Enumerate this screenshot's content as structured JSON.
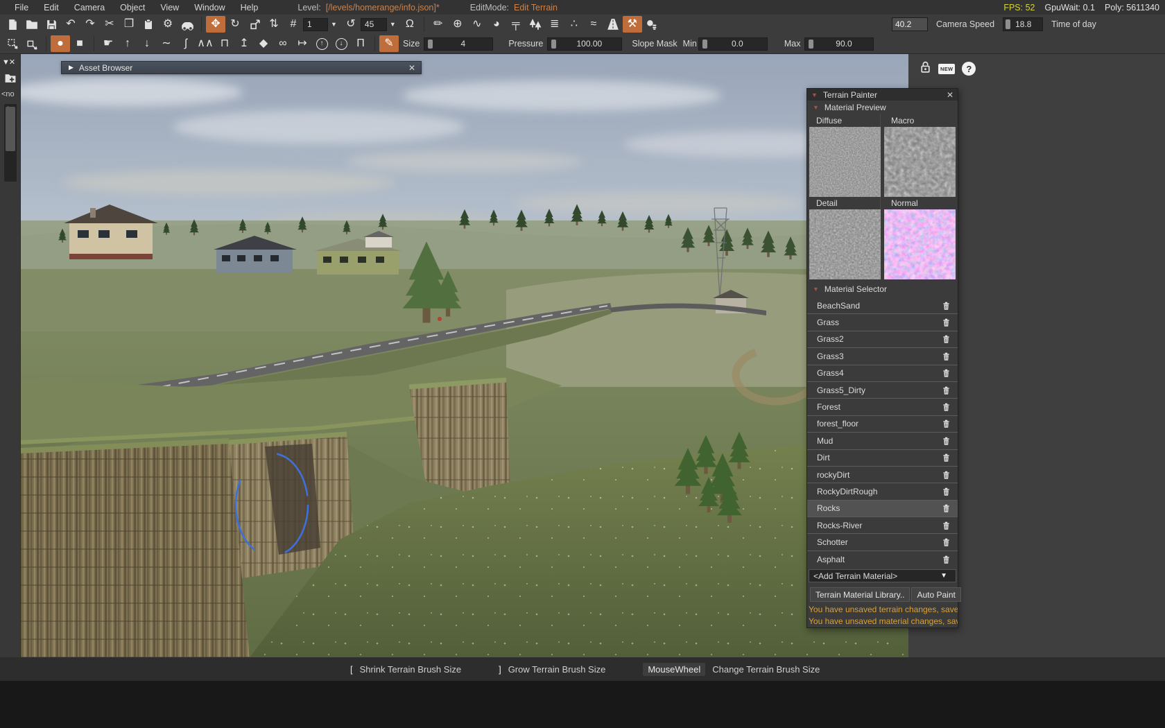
{
  "menubar": {
    "items": [
      "File",
      "Edit",
      "Camera",
      "Object",
      "View",
      "Window",
      "Help"
    ],
    "level_label": "Level:",
    "level_value": "[/levels/homerange/info.json]*",
    "editmode_label": "EditMode:",
    "editmode_value": "Edit Terrain",
    "fps": "FPS: 52",
    "gpuwait": "GpuWait: 0.1",
    "poly": "Poly: 5611340"
  },
  "toolbar_main": {
    "grid_snap_value": "1",
    "rotate_snap_value": "45",
    "camera_speed_value": "40.2",
    "camera_speed_label": "Camera Speed",
    "time_of_day_value": "18.8",
    "time_of_day_label": "Time of day"
  },
  "brush_bar": {
    "size_label": "Size",
    "size_value": "4",
    "pressure_label": "Pressure",
    "pressure_value": "100.00",
    "slope_mask_label": "Slope Mask",
    "min_label": "Min",
    "min_value": "0.0",
    "max_label": "Max",
    "max_value": "90.0"
  },
  "asset_browser": {
    "title": "Asset Browser"
  },
  "left_strip": {
    "none_label": "<no",
    "scroll_index": "1"
  },
  "help_cluster": {
    "new_badge": "NEW",
    "help_glyph": "?"
  },
  "terrain_painter": {
    "title": "Terrain Painter",
    "preview": {
      "title": "Material Preview",
      "labels": [
        "Diffuse",
        "Macro",
        "Detail",
        "Normal"
      ]
    },
    "selector": {
      "title": "Material Selector",
      "materials": [
        {
          "name": "BeachSand"
        },
        {
          "name": "Grass"
        },
        {
          "name": "Grass2"
        },
        {
          "name": "Grass3"
        },
        {
          "name": "Grass4"
        },
        {
          "name": "Grass5_Dirty"
        },
        {
          "name": "Forest"
        },
        {
          "name": "forest_floor"
        },
        {
          "name": "Mud"
        },
        {
          "name": "Dirt"
        },
        {
          "name": "rockyDirt"
        },
        {
          "name": "RockyDirtRough"
        },
        {
          "name": "Rocks"
        },
        {
          "name": "Rocks-River"
        },
        {
          "name": "Schotter"
        },
        {
          "name": "Asphalt"
        }
      ],
      "selected_material": "Rocks",
      "add_dropdown": "<Add Terrain Material>",
      "library_button": "Terrain Material Library..",
      "auto_paint_button": "Auto Paint"
    },
    "warnings": [
      "You have unsaved terrain changes, save l",
      "You have unsaved material changes, save"
    ]
  },
  "statusbar": {
    "entries": [
      {
        "key": "[",
        "label": "Shrink Terrain Brush Size"
      },
      {
        "key": "]",
        "label": "Grow Terrain Brush Size"
      },
      {
        "key": "MouseWheel",
        "label": "Change Terrain Brush Size"
      }
    ]
  },
  "icons": {
    "undo": "↶",
    "redo": "↷",
    "cut": "✂",
    "copy": "❐",
    "gear": "⚙",
    "move": "✥",
    "rotate": "↻",
    "ruler_w": "⇅",
    "grid": "#",
    "rot_snap": "↺",
    "magnet": "Ω",
    "pencil": "✏",
    "add": "⊕",
    "spline": "∿",
    "sphere": "◕",
    "roller": "╤",
    "layers": "≣",
    "particles": "∴",
    "river": "≈",
    "hammer": "⚒",
    "decal": "❋",
    "circle_brush": "●",
    "square_brush": "■",
    "hand": "☛",
    "raise": "↑",
    "lower": "↓",
    "smooth": "∼",
    "slope": "ʃ",
    "noise": "∧∧",
    "flatten": "⊓",
    "set_height": "↥",
    "erase": "◆",
    "smudge": "∞",
    "ruler_r": "↦",
    "avg_up": "↑",
    "avg_down": "↓",
    "bridge": "Π",
    "paint": "✎",
    "dropdown": "▼",
    "section": "▼",
    "expand": "▶",
    "close": "✕",
    "filter": "▼✕"
  },
  "colors": {
    "accent_orange": "#bf6d3b",
    "warning_amber": "#d9a238",
    "fps_yellow": "#d3d53a",
    "level_path_orange": "#c8834f",
    "brush_cursor_blue": "#3f6fd8"
  }
}
